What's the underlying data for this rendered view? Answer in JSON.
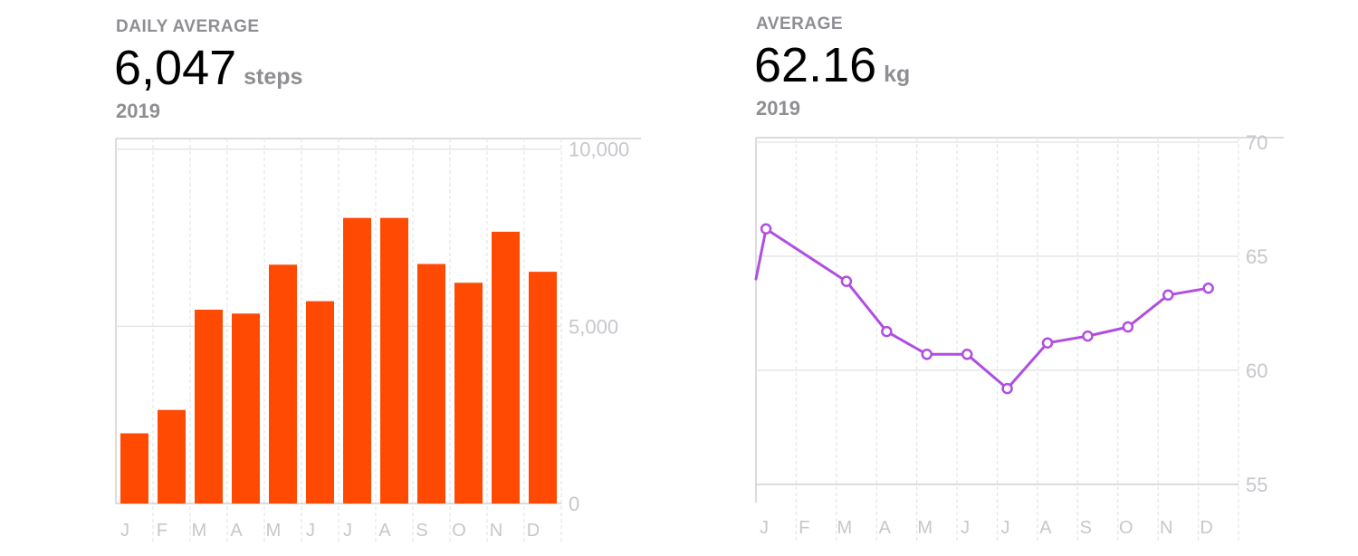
{
  "steps": {
    "label": "DAILY AVERAGE",
    "value": "6,047",
    "unit": "steps",
    "period": "2019"
  },
  "weight": {
    "label": "AVERAGE",
    "value": "62.16",
    "unit": "kg",
    "period": "2019"
  },
  "colors": {
    "bar": "#ff4a03",
    "line": "#b04ee0",
    "grid": "#e5e5ea",
    "axis_text": "#c7c7cc"
  },
  "chart_data": [
    {
      "type": "bar",
      "title": "",
      "categories": [
        "J",
        "F",
        "M",
        "A",
        "M",
        "J",
        "J",
        "A",
        "S",
        "O",
        "N",
        "D"
      ],
      "values": [
        1980,
        2640,
        5470,
        5360,
        6740,
        5710,
        8060,
        8060,
        6760,
        6230,
        7670,
        6540
      ],
      "yticks": [
        10000,
        5000,
        0
      ],
      "ytick_labels": [
        "10,000",
        "5,000",
        "0"
      ],
      "ylim": [
        0,
        10300
      ],
      "grid": true,
      "xlabel": "",
      "ylabel": ""
    },
    {
      "type": "line",
      "title": "",
      "categories": [
        "J",
        "F",
        "M",
        "A",
        "M",
        "J",
        "J",
        "A",
        "S",
        "O",
        "N",
        "D"
      ],
      "values": [
        66.2,
        63.9,
        61.7,
        60.7,
        60.7,
        59.2,
        61.2,
        61.5,
        61.9,
        63.3,
        63.6
      ],
      "point_positions": [
        0.25,
        2.25,
        3.25,
        4.25,
        5.25,
        6.25,
        7.25,
        8.25,
        9.25,
        10.25,
        11.25
      ],
      "left_edge_value": 64.0,
      "yticks": [
        70,
        65,
        60,
        55
      ],
      "ytick_labels": [
        "70",
        "65",
        "60",
        "55"
      ],
      "ylim": [
        54.2,
        70.2
      ],
      "grid": true,
      "xlabel": "",
      "ylabel": ""
    }
  ]
}
